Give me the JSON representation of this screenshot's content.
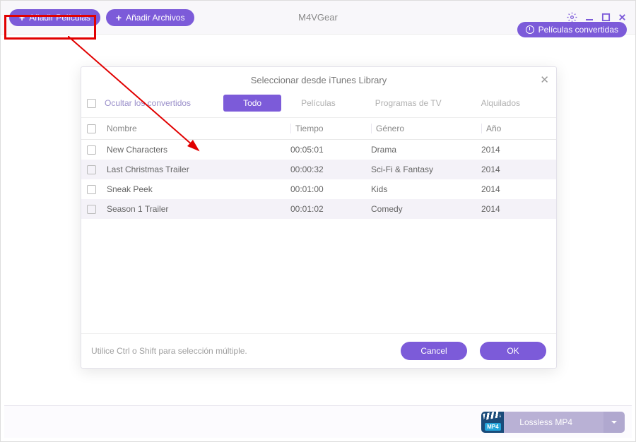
{
  "app": {
    "title": "M4VGear"
  },
  "header": {
    "add_movies": "Añadir Películas",
    "add_files": "Añadir Archivos",
    "converted_movies": "Películas convertidas"
  },
  "modal": {
    "title": "Seleccionar desde iTunes Library",
    "hide_converted": "Ocultar los convertidos",
    "tabs": {
      "all": "Todo",
      "movies": "Películas",
      "tv": "Programas de TV",
      "rented": "Alquilados"
    },
    "columns": {
      "name": "Nombre",
      "time": "Tiempo",
      "genre": "Género",
      "year": "Año"
    },
    "rows": [
      {
        "name": "New Characters",
        "time": "00:05:01",
        "genre": "Drama",
        "year": "2014"
      },
      {
        "name": "Last Christmas Trailer",
        "time": "00:00:32",
        "genre": "Sci-Fi & Fantasy",
        "year": "2014"
      },
      {
        "name": "Sneak Peek",
        "time": "00:01:00",
        "genre": "Kids",
        "year": "2014"
      },
      {
        "name": "Season 1 Trailer",
        "time": "00:01:02",
        "genre": "Comedy",
        "year": "2014"
      }
    ],
    "hint": "Utilice Ctrl o Shift para selección múltiple.",
    "cancel": "Cancel",
    "ok": "OK"
  },
  "footer": {
    "format_label": "Lossless MP4",
    "mp4_badge": "MP4"
  }
}
